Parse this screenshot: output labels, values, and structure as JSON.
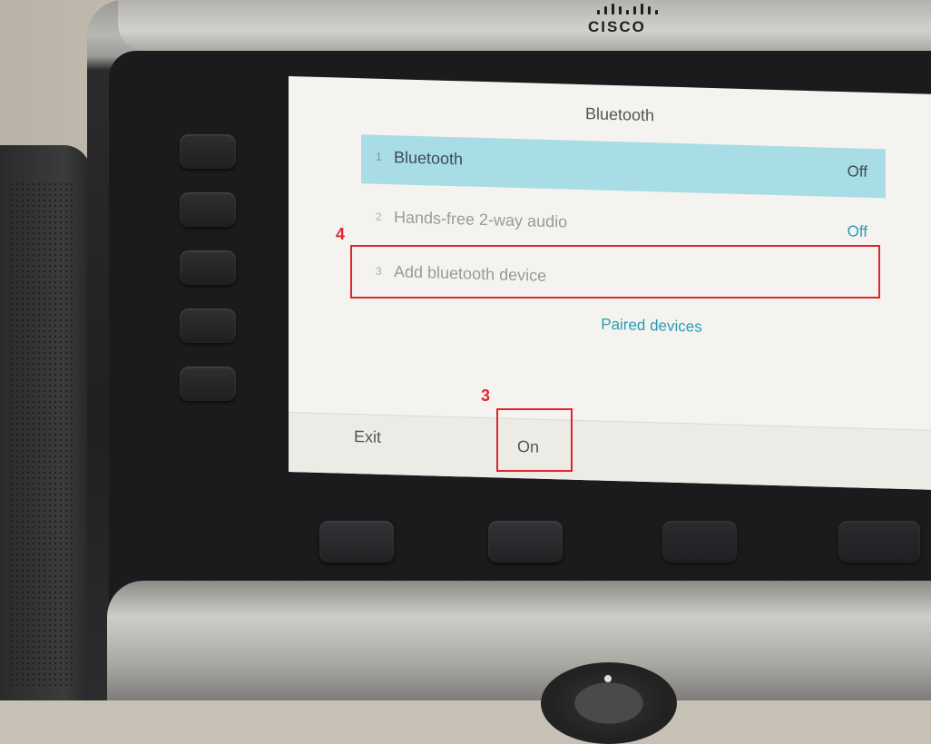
{
  "brand": {
    "logo": "CISCO"
  },
  "screen": {
    "title": "Bluetooth",
    "items": [
      {
        "num": "1",
        "label": "Bluetooth",
        "value": "Off",
        "selected": true
      },
      {
        "num": "2",
        "label": "Hands-free 2-way audio",
        "value": "Off"
      },
      {
        "num": "3",
        "label": "Add bluetooth device",
        "value": ""
      }
    ],
    "link": "Paired devices"
  },
  "softkeys": {
    "exit": "Exit",
    "on": "On"
  },
  "annotations": {
    "step3": "3",
    "step4": "4"
  },
  "colors": {
    "accent": "#2b9bb5",
    "selected_row": "#a9dde6",
    "annotation": "#e0262c"
  }
}
